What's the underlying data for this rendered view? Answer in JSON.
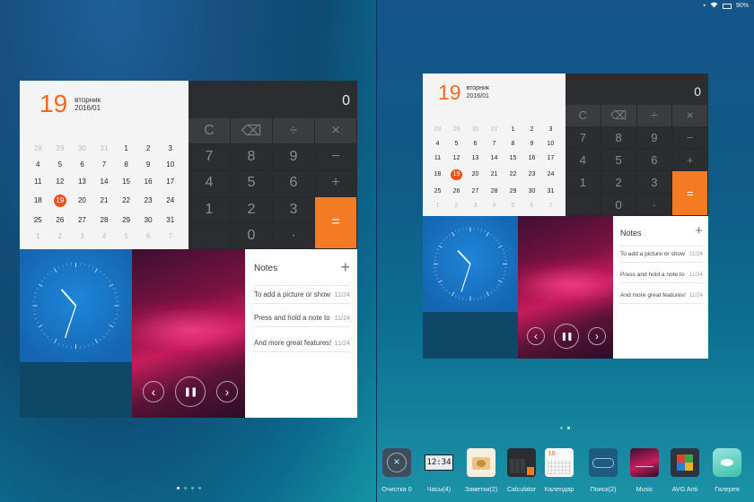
{
  "status": {
    "battery": "90%"
  },
  "calendar": {
    "day": "19",
    "weekday": "вторник",
    "month": "2016/01",
    "weeks": [
      [
        "28",
        "29",
        "30",
        "31",
        "1",
        "2",
        "3"
      ],
      [
        "4",
        "5",
        "6",
        "7",
        "8",
        "9",
        "10"
      ],
      [
        "11",
        "12",
        "13",
        "14",
        "15",
        "16",
        "17"
      ],
      [
        "18",
        "19",
        "20",
        "21",
        "22",
        "23",
        "24"
      ],
      [
        "25",
        "26",
        "27",
        "28",
        "29",
        "30",
        "31"
      ],
      [
        "1",
        "2",
        "3",
        "4",
        "5",
        "6",
        "7"
      ]
    ]
  },
  "calculator": {
    "display": "0",
    "keys": [
      "C",
      "⌫",
      "÷",
      "×",
      "7",
      "8",
      "9",
      "−",
      "4",
      "5",
      "6",
      "+",
      "1",
      "2",
      "3",
      "=",
      "",
      "0",
      "·",
      ""
    ]
  },
  "notes": {
    "title": "Notes",
    "add": "+",
    "items": [
      {
        "text": "To add a picture or show",
        "date": "11/24"
      },
      {
        "text": "Press and hold a note to",
        "date": "11/24"
      },
      {
        "text": "And more great features!",
        "date": "11/24"
      }
    ]
  },
  "music": {
    "prev": "‹",
    "pause": "❚❚",
    "next": "›"
  },
  "dock": [
    {
      "label": "Очистка 0",
      "icon": "cleaner-icon"
    },
    {
      "label": "Часы(4)",
      "icon": "clock-icon",
      "clock_text": "12:34"
    },
    {
      "label": "Заметки(2)",
      "icon": "notes-icon"
    },
    {
      "label": "Calculator",
      "icon": "calculator-icon"
    },
    {
      "label": "Календар",
      "icon": "calendar-icon"
    },
    {
      "label": "Поиск(2)",
      "icon": "search-icon"
    },
    {
      "label": "Music",
      "icon": "music-icon"
    },
    {
      "label": "AVG Anti",
      "icon": "avg-icon"
    },
    {
      "label": "Галерея",
      "icon": "gallery-icon"
    }
  ],
  "colors": {
    "accent": "#f26b1d",
    "today": "#f0511d",
    "equals": "#f47a24"
  }
}
